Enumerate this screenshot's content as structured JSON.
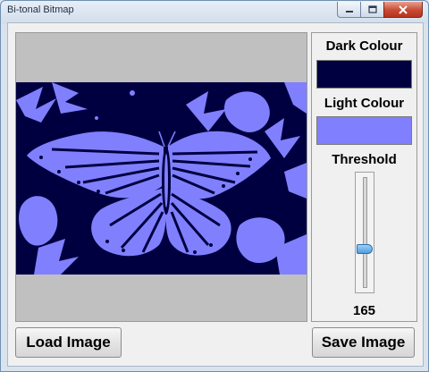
{
  "window": {
    "title": "Bi-tonal Bitmap"
  },
  "colors": {
    "dark": "#000040",
    "light": "#8080ff",
    "image_background": "#c0c0c0"
  },
  "panel": {
    "dark_label": "Dark Colour",
    "light_label": "Light Colour",
    "threshold_label": "Threshold",
    "threshold_value": "165"
  },
  "slider": {
    "min": 0,
    "max": 255,
    "value": 165
  },
  "buttons": {
    "load": "Load Image",
    "save": "Save Image"
  },
  "image": {
    "subject": "butterfly-bitmap"
  }
}
